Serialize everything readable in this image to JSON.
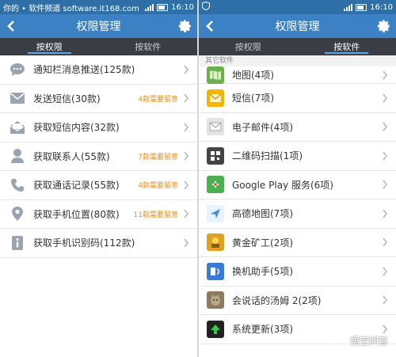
{
  "left": {
    "status": {
      "text": "你的 • 软件频道 software.it168.com",
      "time": "16:10"
    },
    "title": "权限管理",
    "tabs": [
      {
        "label": "按权限",
        "active": true
      },
      {
        "label": "按软件",
        "active": false
      }
    ],
    "items": [
      {
        "label": "通知栏消息推送(125款)",
        "note": "",
        "icon": "chat-bubble-icon"
      },
      {
        "label": "发送短信(30款)",
        "note": "4款需要留意",
        "icon": "envelope-icon"
      },
      {
        "label": "获取短信内容(32款)",
        "note": "",
        "icon": "open-envelope-icon"
      },
      {
        "label": "获取联系人(55款)",
        "note": "7款需要留意",
        "icon": "person-icon"
      },
      {
        "label": "获取通话记录(55款)",
        "note": "4款需要留意",
        "icon": "phone-icon"
      },
      {
        "label": "获取手机位置(80款)",
        "note": "11款需要留意",
        "icon": "location-pin-icon"
      },
      {
        "label": "获取手机识别码(112款)",
        "note": "",
        "icon": "info-icon"
      }
    ]
  },
  "right": {
    "status": {
      "time": "16:10"
    },
    "title": "权限管理",
    "tabs": [
      {
        "label": "按权限",
        "active": false
      },
      {
        "label": "按软件",
        "active": true
      }
    ],
    "section": "其它软件",
    "items": [
      {
        "label": "地图(4项)",
        "icon": "map-app-icon",
        "color": "#6ab04c"
      },
      {
        "label": "短信(7项)",
        "icon": "sms-app-icon",
        "color": "#f4b400"
      },
      {
        "label": "电子邮件(4项)",
        "icon": "email-app-icon",
        "color": "#cfcfcf"
      },
      {
        "label": "二维码扫描(1项)",
        "icon": "qr-scanner-app-icon",
        "color": "#444444"
      },
      {
        "label": "Google Play 服务(6项)",
        "icon": "google-play-services-icon",
        "color": "#4caf50"
      },
      {
        "label": "高德地图(7项)",
        "icon": "amap-app-icon",
        "color": "#3f8fe0"
      },
      {
        "label": "黄金矿工(2项)",
        "icon": "gold-miner-app-icon",
        "color": "#e0a020"
      },
      {
        "label": "换机助手(5项)",
        "icon": "phone-switch-app-icon",
        "color": "#3a7bd5"
      },
      {
        "label": "会说话的汤姆 2(2项)",
        "icon": "talking-tom-app-icon",
        "color": "#8d7b5e"
      },
      {
        "label": "系统更新(3项)",
        "icon": "system-update-app-icon",
        "color": "#2e8b3a"
      }
    ]
  },
  "watermark": "悟空问答"
}
